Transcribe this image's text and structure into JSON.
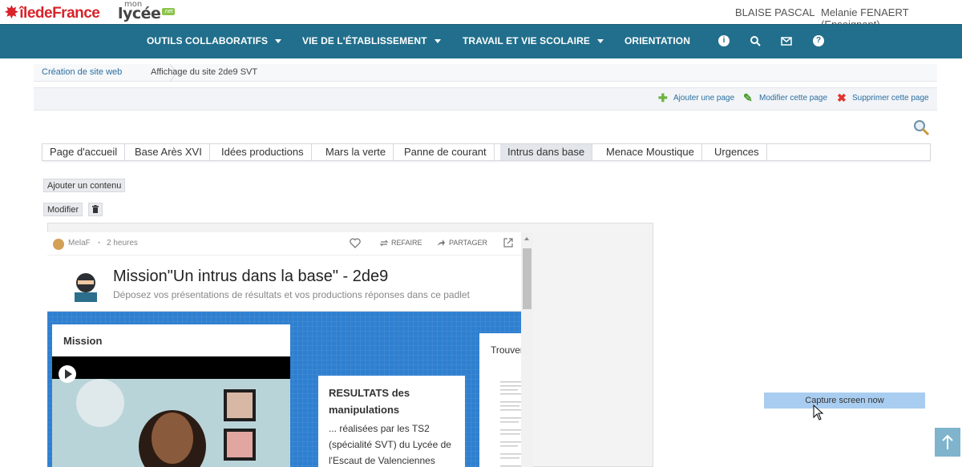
{
  "header": {
    "logo_idf": "îledeFrance",
    "logo_mon": "mon",
    "logo_lycee": "lycée",
    "logo_net": ".net",
    "school": "BLAISE PASCAL",
    "user": "Melanie FENAERT (Enseignant)"
  },
  "nav": {
    "items": [
      {
        "label": "OUTILS COLLABORATIFS",
        "has_caret": true
      },
      {
        "label": "VIE DE L'ÉTABLISSEMENT",
        "has_caret": true
      },
      {
        "label": "TRAVAIL ET VIE SCOLAIRE",
        "has_caret": true
      },
      {
        "label": "ORIENTATION",
        "has_caret": false
      }
    ],
    "icons": [
      "info-icon",
      "search-icon",
      "mail-icon",
      "help-icon"
    ],
    "color": "#216f8c"
  },
  "breadcrumb": {
    "items": [
      "Création de site web",
      "Affichage du site 2de9 SVT"
    ]
  },
  "actions": {
    "add": "Ajouter une page",
    "edit": "Modifier cette page",
    "delete": "Supprimer cette page"
  },
  "tabs": [
    {
      "label": "Page d'accueil",
      "active": false
    },
    {
      "label": "Base Arès XVI",
      "active": false
    },
    {
      "label": "Idées productions",
      "active": false
    },
    {
      "label": "Mars la verte",
      "active": false
    },
    {
      "label": "Panne de courant",
      "active": false
    },
    {
      "label": "Intrus dans base",
      "active": true
    },
    {
      "label": "Menace Moustique",
      "active": false
    },
    {
      "label": "Urgences",
      "active": false
    }
  ],
  "buttons": {
    "add_content": "Ajouter un contenu",
    "modify": "Modifier"
  },
  "padlet": {
    "author": "MelaF",
    "dot": "•",
    "time": "2 heures",
    "redo": "REFAIRE",
    "share": "PARTAGER",
    "title": "Mission\"Un intrus dans la base\" - 2de9",
    "subtitle": "Déposez vos présentations de résultats et vos productions réponses dans ce padlet",
    "board_color": "#2f7fd0",
    "cards": {
      "mission_title": "Mission",
      "result_title": "RESULTATS des manipulations",
      "result_body": "... réalisées par les TS2 (spécialité SVT) du Lycée de l'Escaut de Valenciennes",
      "trouve_title": "Trouver"
    }
  },
  "overlay": {
    "capture": "Capture screen now"
  }
}
